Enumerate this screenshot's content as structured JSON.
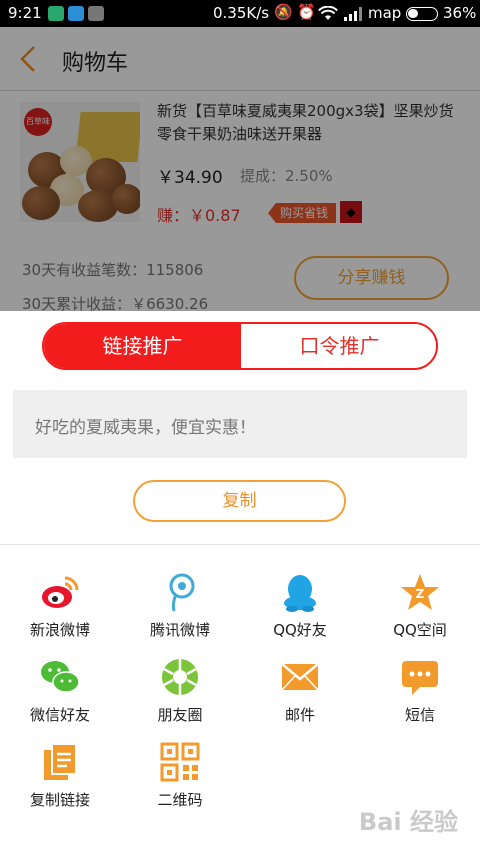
{
  "status_bar": {
    "time": "9:21",
    "speed": "0.35K/s",
    "carrier": "map",
    "battery_pct": "36%",
    "battery_level": 0.36
  },
  "background": {
    "header_title": "购物车",
    "product": {
      "logo_text": "百草味",
      "title": "新货【百草味夏威夷果200gx3袋】坚果炒货零食干果奶油味送开果器",
      "price": "￥34.90",
      "commission": "提成：2.50%",
      "earn": "赚：￥0.87",
      "tag": "购买省钱"
    },
    "stats": {
      "count_30d": "30天有收益笔数：115806",
      "income_30d": "30天累计收益：￥6630.26"
    },
    "share_button": "分享赚钱"
  },
  "sheet": {
    "tabs": [
      {
        "label": "链接推广"
      },
      {
        "label": "口令推广"
      }
    ],
    "share_text": "好吃的夏威夷果，便宜实惠！",
    "copy_button": "复制",
    "options": [
      {
        "label": "新浪微博",
        "icon": "weibo-icon",
        "color": "#e6162d"
      },
      {
        "label": "腾讯微博",
        "icon": "tencent-weibo-icon",
        "color": "#3fa9d8"
      },
      {
        "label": "QQ好友",
        "icon": "qq-icon",
        "color": "#21a4e4"
      },
      {
        "label": "QQ空间",
        "icon": "qzone-icon",
        "color": "#f39a2c"
      },
      {
        "label": "微信好友",
        "icon": "wechat-icon",
        "color": "#4dbb35"
      },
      {
        "label": "朋友圈",
        "icon": "moments-icon",
        "color": "#7cc53b"
      },
      {
        "label": "邮件",
        "icon": "mail-icon",
        "color": "#f39a2c"
      },
      {
        "label": "短信",
        "icon": "sms-icon",
        "color": "#f39a2c"
      },
      {
        "label": "复制链接",
        "icon": "copy-link-icon",
        "color": "#f39a2c"
      },
      {
        "label": "二维码",
        "icon": "qr-code-icon",
        "color": "#f39a2c"
      }
    ]
  },
  "watermark": "Bai 经验",
  "colors": {
    "accent_red": "#f21c1c",
    "accent_orange": "#f0a236"
  }
}
